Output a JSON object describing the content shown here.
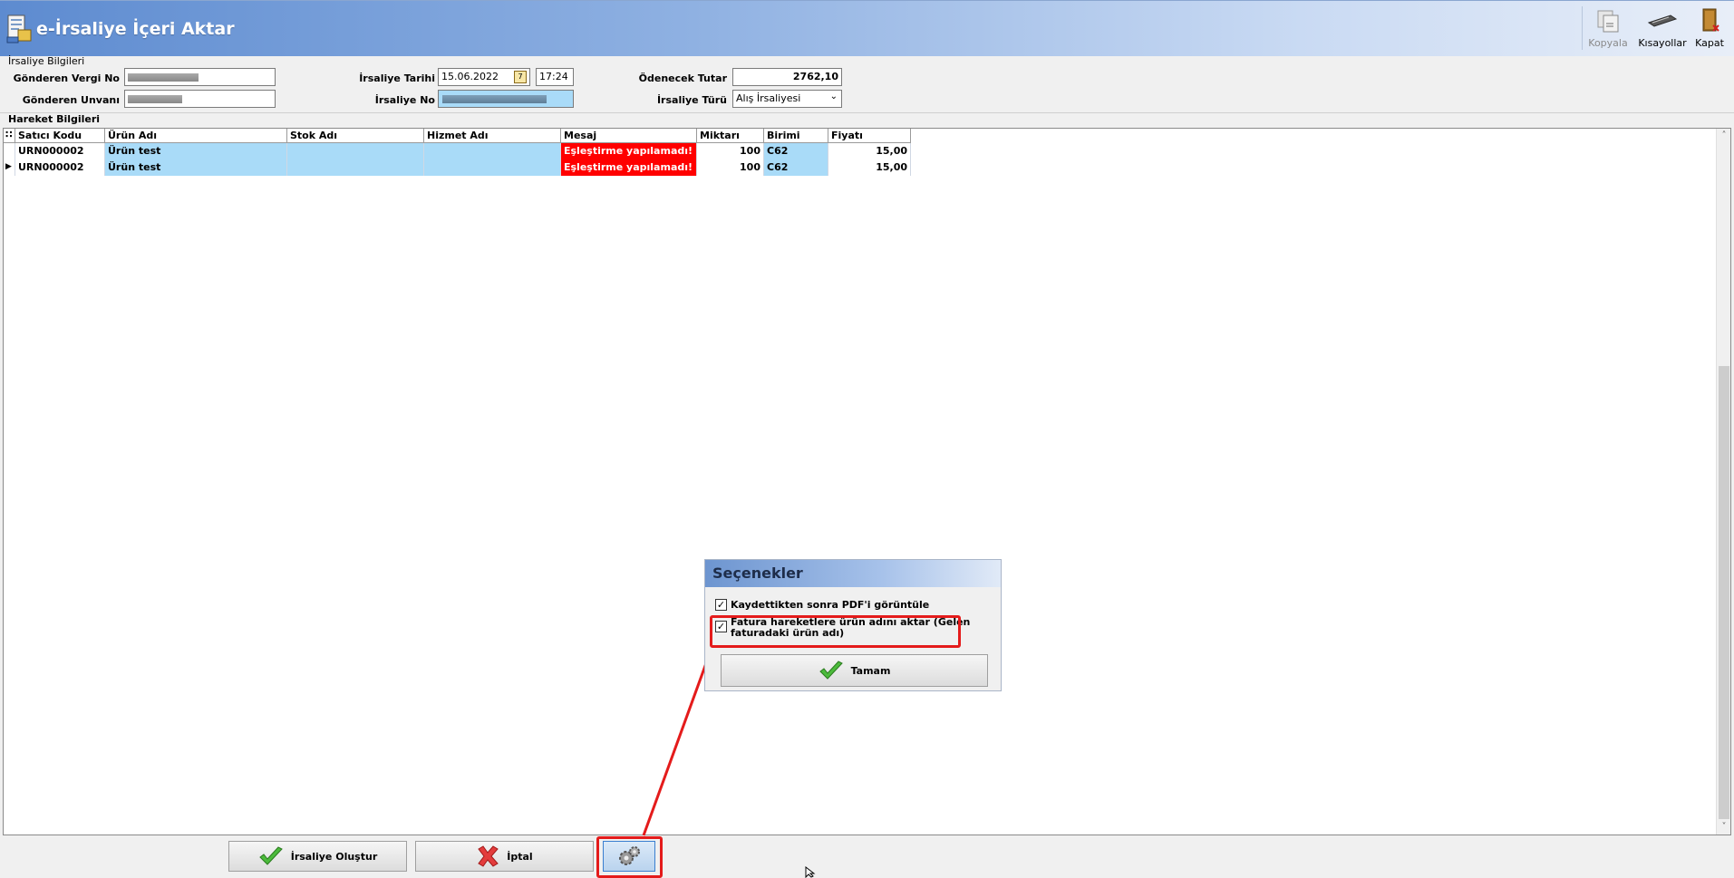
{
  "window": {
    "title": "e-İrsaliye İçeri Aktar",
    "toolbar": {
      "copy_label": "Kopyala",
      "shortcuts_label": "Kısayollar",
      "close_label": "Kapat"
    }
  },
  "irsaliye_info": {
    "section_label": "İrsaliye Bilgileri",
    "sender_tax_no_label": "Gönderen Vergi No",
    "sender_title_label": "Gönderen Unvanı",
    "date_label": "İrsaliye Tarihi",
    "date_value": "15.06.2022",
    "time_value": "17:24",
    "number_label": "İrsaliye No",
    "amount_label": "Ödenecek Tutar",
    "amount_value": "2762,10",
    "type_label": "İrsaliye Türü",
    "type_value": "Alış İrsaliyesi"
  },
  "movements": {
    "section_label": "Hareket Bilgileri",
    "columns": [
      "Satıcı Kodu",
      "Ürün Adı",
      "Stok Adı",
      "Hizmet Adı",
      "Mesaj",
      "Miktarı",
      "Birimi",
      "Fiyatı"
    ],
    "rows": [
      {
        "vendor_code": "URN000002",
        "product": "Ürün test",
        "stock": "",
        "service": "",
        "message": "Eşleştirme yapılamadı!",
        "qty": "100",
        "unit": "C62",
        "price": "15,00"
      },
      {
        "vendor_code": "URN000002",
        "product": "Ürün test",
        "stock": "",
        "service": "",
        "message": "Eşleştirme yapılamadı!",
        "qty": "100",
        "unit": "C62",
        "price": "15,00"
      }
    ]
  },
  "buttons": {
    "create": "İrsaliye Oluştur",
    "cancel": "İptal"
  },
  "options_popup": {
    "title": "Seçenekler",
    "option1": "Kaydettikten sonra PDF'i görüntüle",
    "option1_checked": true,
    "option2_line1": "Fatura hareketlere ürün adını aktar (Gelen",
    "option2_line2": "faturadaki ürün adı)",
    "option2_checked": true,
    "ok": "Tamam"
  },
  "colors": {
    "title_gradient_start": "#5d8bd0",
    "row_highlight": "#a9dbf8",
    "error_cell": "#ff0000",
    "annotation_red": "#e41b1b"
  }
}
